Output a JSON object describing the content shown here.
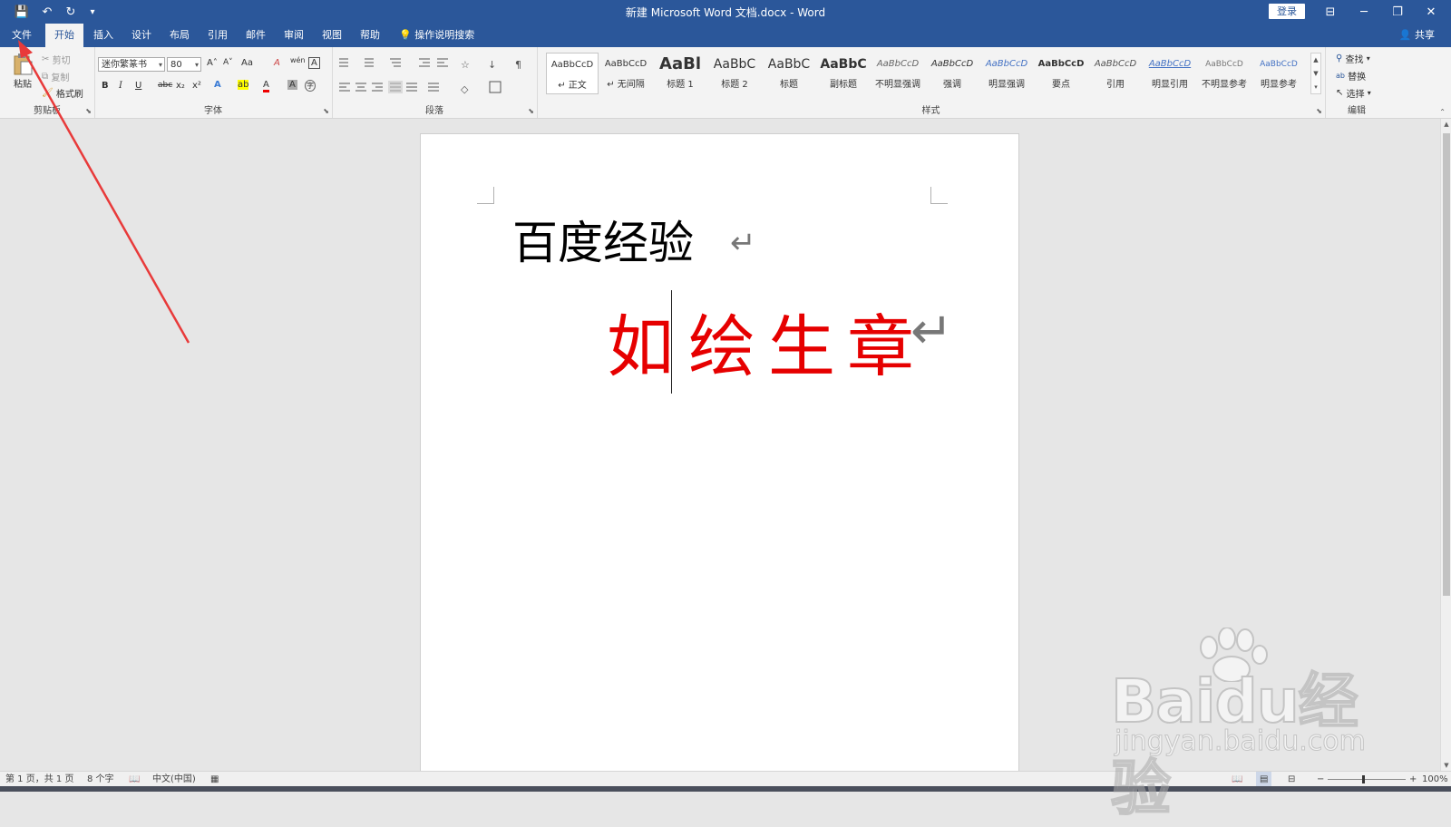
{
  "window": {
    "title": "新建 Microsoft Word 文档.docx  -  Word",
    "login_label": "登录",
    "minimize": "─",
    "restore": "❐",
    "close": "✕",
    "ribbon_display": "⊟"
  },
  "quick_access": {
    "save": "💾",
    "undo": "↶",
    "redo": "↻",
    "customize": "▾"
  },
  "tabs": [
    {
      "label": "文件"
    },
    {
      "label": "开始"
    },
    {
      "label": "插入"
    },
    {
      "label": "设计"
    },
    {
      "label": "布局"
    },
    {
      "label": "引用"
    },
    {
      "label": "邮件"
    },
    {
      "label": "审阅"
    },
    {
      "label": "视图"
    },
    {
      "label": "帮助"
    }
  ],
  "tell_me": "操作说明搜索",
  "share": "共享",
  "ribbon": {
    "clipboard": {
      "label": "剪贴板",
      "paste": "粘贴",
      "cut": "剪切",
      "copy": "复制",
      "format_painter": "格式刷"
    },
    "font": {
      "label": "字体",
      "font_name": "迷你繁篆书",
      "font_size": "80",
      "grow": "A˄",
      "shrink": "A˅",
      "change_case": "Aa",
      "clear_format": "A",
      "wen": "wén",
      "char_border": "A",
      "bold": "B",
      "italic": "I",
      "underline": "U",
      "strike": "abc",
      "sub": "x₂",
      "sup": "x²",
      "text_effects": "A",
      "highlight": "ab",
      "font_color": "A",
      "char_shading": "A",
      "enclose": "字"
    },
    "paragraph": {
      "label": "段落"
    },
    "styles": {
      "label": "样式",
      "items": [
        {
          "preview": "AaBbCcD",
          "name": "↵ 正文"
        },
        {
          "preview": "AaBbCcD",
          "name": "↵ 无间隔"
        },
        {
          "preview": "AaBl",
          "name": "标题 1"
        },
        {
          "preview": "AaBbC",
          "name": "标题 2"
        },
        {
          "preview": "AaBbC",
          "name": "标题"
        },
        {
          "preview": "AaBbC",
          "name": "副标题"
        },
        {
          "preview": "AaBbCcD",
          "name": "不明显强调"
        },
        {
          "preview": "AaBbCcD",
          "name": "强调"
        },
        {
          "preview": "AaBbCcD",
          "name": "明显强调"
        },
        {
          "preview": "AaBbCcD",
          "name": "要点"
        },
        {
          "preview": "AaBbCcD",
          "name": "引用"
        },
        {
          "preview": "AaBbCcD",
          "name": "明显引用"
        },
        {
          "preview": "AaBbCcD",
          "name": "不明显参考"
        },
        {
          "preview": "AaBbCcD",
          "name": "明显参考"
        }
      ]
    },
    "editing": {
      "label": "编辑",
      "find": "查找",
      "replace": "替换",
      "select": "选择"
    }
  },
  "document": {
    "line1": "百度经验",
    "line2": [
      "如",
      "绘",
      "生",
      "章"
    ],
    "para_mark": "↵"
  },
  "status": {
    "page": "第 1 页，共 1 页",
    "words": "8 个字",
    "language": "中文(中国)",
    "zoom": "100%",
    "zoom_minus": "−",
    "zoom_plus": "+"
  },
  "watermark": {
    "brand": "Baidu经验",
    "url": "jingyan.baidu.com"
  },
  "colors": {
    "accent": "#2b579a",
    "seal_red": "#e60000",
    "annotation_arrow": "#e83a3a"
  }
}
